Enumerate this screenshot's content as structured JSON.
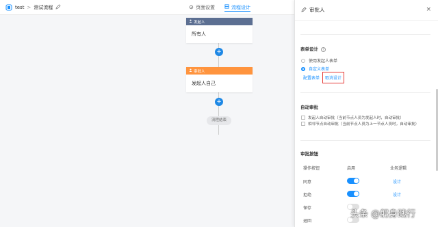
{
  "header": {
    "crumb_root": "test",
    "crumb_sep": ">",
    "crumb_current": "测试流程",
    "tabs": [
      {
        "label": "页面设置",
        "active": false
      },
      {
        "label": "流程设计",
        "active": true
      }
    ]
  },
  "flow": {
    "initiator": {
      "title": "发起人",
      "body": "所有人",
      "color": "#5c6f92"
    },
    "approver": {
      "title": "审批人",
      "body": "发起人自己",
      "color": "#ff943e"
    },
    "end_label": "流程结束",
    "add_glyph": "+"
  },
  "panel": {
    "title": "审批人",
    "close_glyph": "×",
    "form_design": {
      "title": "表单设计",
      "help_glyph": "?",
      "options": [
        {
          "label": "使用发起人表单",
          "checked": false
        },
        {
          "label": "自定义表单",
          "checked": true
        }
      ],
      "config_link": "配置表单",
      "cancel_link": "取消设计"
    },
    "auto_approve": {
      "title": "自动审批",
      "options": [
        "发起人自动审批（当前节点人员为发起人时，自动审批）",
        "相邻节点自动审批（当前节点人员为上一节点人员时，自动审批）"
      ]
    },
    "buttons": {
      "title": "审批按钮",
      "headers": [
        "操作按钮",
        "启用",
        "业务逻辑"
      ],
      "rows": [
        {
          "label": "同意",
          "enabled": true,
          "logic": "设计"
        },
        {
          "label": "拒绝",
          "enabled": true,
          "logic": "设计"
        },
        {
          "label": "保存",
          "enabled": false,
          "logic": ""
        },
        {
          "label": "退回",
          "enabled": false,
          "logic": ""
        }
      ]
    }
  },
  "watermark": "头条 @躬身践行",
  "icons": {
    "home": "home-icon",
    "edit": "edit-icon",
    "settings": "gear-icon",
    "flow": "flow-icon",
    "user": "user-icon",
    "close": "close-icon"
  }
}
